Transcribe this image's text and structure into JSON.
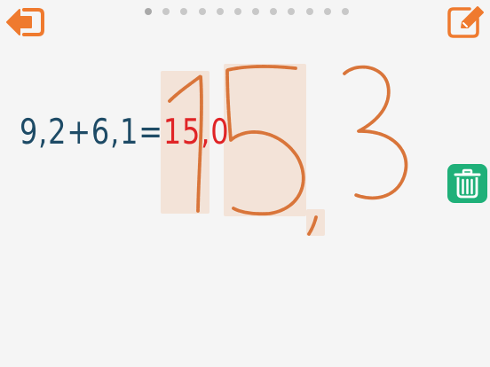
{
  "toolbar": {
    "back_icon": "exit-arrow-icon",
    "edit_icon": "pencil-square-icon",
    "accent_color": "#ef7a2e"
  },
  "pagination": {
    "total": 12,
    "current": 1
  },
  "exercise": {
    "question": "9,2+6,1=",
    "answer": "15,0",
    "question_color": "#1e4b66",
    "answer_color": "#e02426"
  },
  "handwriting": {
    "stroke_color": "#d9753a",
    "recognized_highlight": "#f3e3d8"
  },
  "actions": {
    "clear_icon": "trash-icon",
    "clear_color": "#1fb079"
  }
}
